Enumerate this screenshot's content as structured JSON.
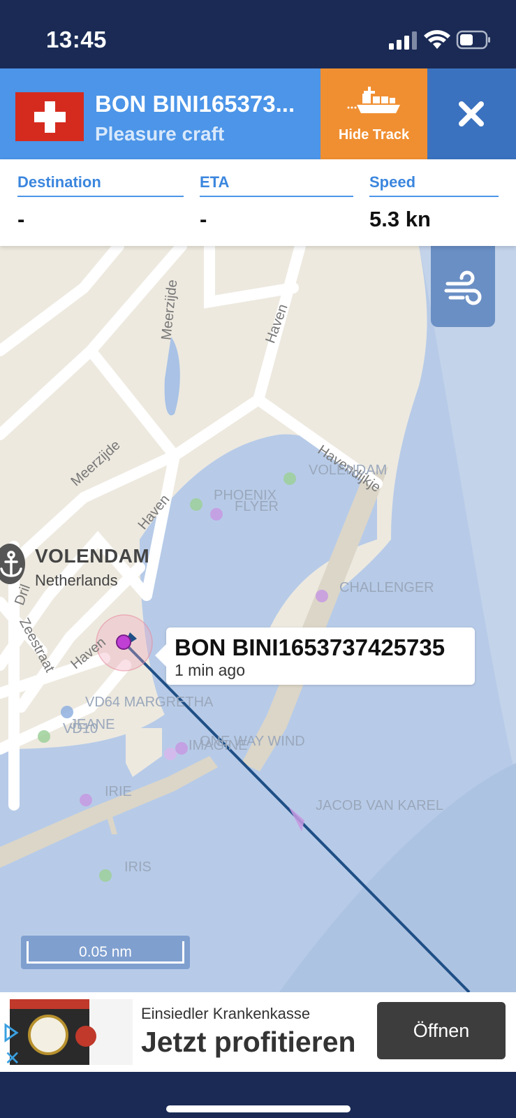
{
  "status_bar": {
    "time": "13:45"
  },
  "vessel": {
    "name": "BON BINI165373...",
    "type": "Pleasure craft",
    "flag": "switzerland-flag-icon"
  },
  "actions": {
    "hide_track_label": "Hide Track"
  },
  "info": {
    "destination_label": "Destination",
    "destination_value": "-",
    "eta_label": "ETA",
    "eta_value": "-",
    "speed_label": "Speed",
    "speed_value": "5.3 kn"
  },
  "map": {
    "place_name": "VOLENDAM",
    "place_country": "Netherlands",
    "streets": [
      "Meerzijde",
      "Haven",
      "Meerzijde",
      "Haven",
      "Dril",
      "Zeestraat",
      "Haven",
      "Havendijkje"
    ],
    "vessels": [
      "VOLENDAM",
      "PHOENIX",
      "FLYER",
      "CHALLENGER",
      "VD64 MARGRETHA",
      "VD10",
      "JEANE",
      "ONE WAY WIND",
      "IMAGINE",
      "IRIE",
      "JACOB VAN KAREL",
      "IRIS"
    ],
    "tooltip_name": "BON BINI1653737425735",
    "tooltip_time": "1 min ago",
    "scale_label": "0.05 nm"
  },
  "ad": {
    "advertiser": "Einsiedler Krankenkasse",
    "headline": "Jetzt profitieren",
    "cta": "Öffnen"
  },
  "colors": {
    "header_blue": "#4c95e8",
    "hide_track_orange": "#f08f31",
    "close_blue": "#3a72bf",
    "status_navy": "#1a2a55",
    "water": "#b7cbe8",
    "land": "#ede9df",
    "track": "#1f4f86"
  }
}
